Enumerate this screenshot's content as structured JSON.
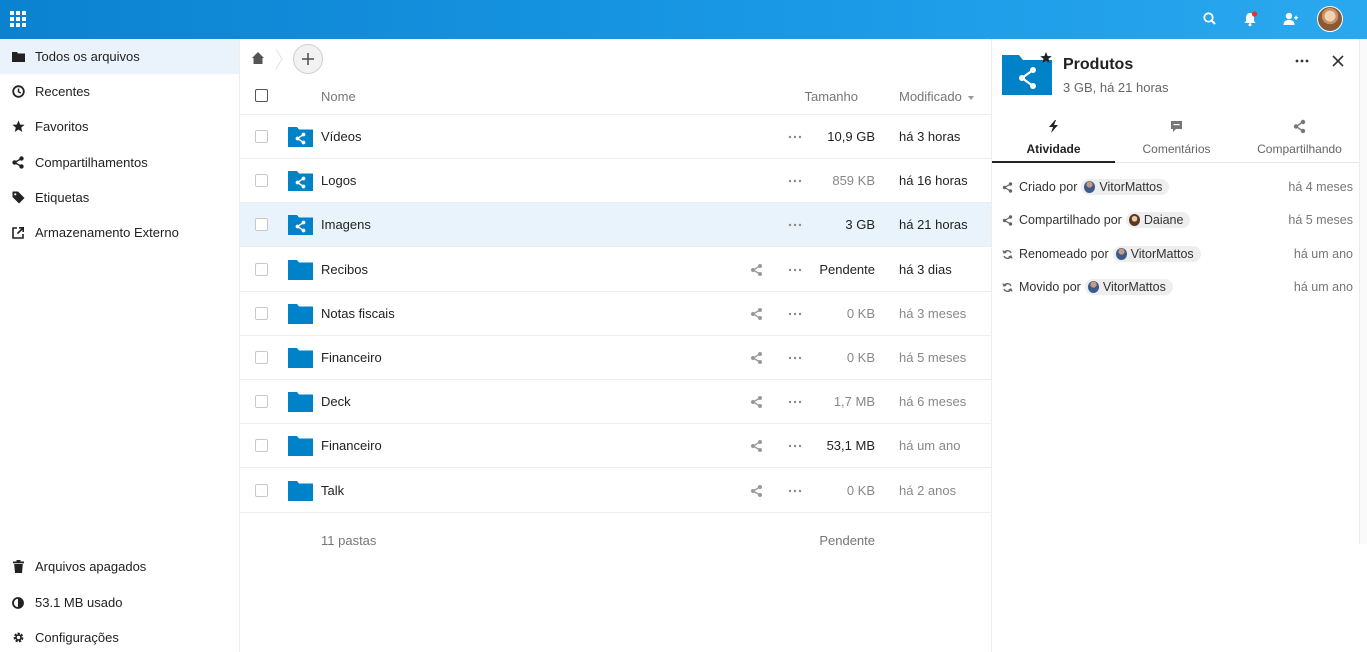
{
  "header": {
    "apps_icon": "apps-grid-icon",
    "search_icon": "search-icon",
    "notifications_icon": "bell-icon",
    "contacts_icon": "contacts-icon",
    "avatar": "user-avatar"
  },
  "sidebar": {
    "items": [
      {
        "label": "Todos os arquivos",
        "icon": "folder-icon"
      },
      {
        "label": "Recentes",
        "icon": "clock-icon"
      },
      {
        "label": "Favoritos",
        "icon": "star-icon"
      },
      {
        "label": "Compartilhamentos",
        "icon": "share-icon"
      },
      {
        "label": "Etiquetas",
        "icon": "tag-icon"
      },
      {
        "label": "Armazenamento Externo",
        "icon": "external-link-icon"
      }
    ],
    "bottom": [
      {
        "label": "Arquivos apagados",
        "icon": "trash-icon"
      },
      {
        "label": "53.1 MB usado",
        "icon": "quota-pie-icon"
      },
      {
        "label": "Configurações",
        "icon": "gear-icon"
      }
    ]
  },
  "files": {
    "columns": {
      "name": "Nome",
      "size": "Tamanho",
      "modified": "Modificado"
    },
    "rows": [
      {
        "name": "Vídeos",
        "size": "10,9 GB",
        "modified": "há 3 horas",
        "shared": true
      },
      {
        "name": "Logos",
        "size": "859 KB",
        "modified": "há 16 horas",
        "shared": true
      },
      {
        "name": "Imagens",
        "size": "3 GB",
        "modified": "há 21 horas",
        "shared": true
      },
      {
        "name": "Recibos",
        "size": "Pendente",
        "modified": "há 3 dias",
        "shared": false
      },
      {
        "name": "Notas fiscais",
        "size": "0 KB",
        "modified": "há 3 meses",
        "shared": false
      },
      {
        "name": "Financeiro",
        "size": "0 KB",
        "modified": "há 5 meses",
        "shared": false
      },
      {
        "name": "Deck",
        "size": "1,7 MB",
        "modified": "há 6 meses",
        "shared": false
      },
      {
        "name": "Financeiro",
        "size": "53,1 MB",
        "modified": "há um ano",
        "shared": false
      },
      {
        "name": "Talk",
        "size": "0 KB",
        "modified": "há 2 anos",
        "shared": false
      }
    ],
    "summary": {
      "count": "11 pastas",
      "size": "Pendente"
    }
  },
  "details": {
    "title": "Produtos",
    "subtitle": "3 GB, há 21 horas",
    "tabs": [
      {
        "label": "Atividade"
      },
      {
        "label": "Comentários"
      },
      {
        "label": "Compartilhando"
      }
    ],
    "activities": [
      {
        "text": "Criado por",
        "user": "VitorMattos",
        "time": "há 4 meses",
        "icon": "share-icon"
      },
      {
        "text": "Compartilhado por",
        "user": "Daiane",
        "time": "há 5 meses",
        "icon": "share-icon"
      },
      {
        "text": "Renomeado por",
        "user": "VitorMattos",
        "time": "há um ano",
        "icon": "refresh-icon"
      },
      {
        "text": "Movido por",
        "user": "VitorMattos",
        "time": "há um ano",
        "icon": "refresh-icon"
      }
    ]
  },
  "colors": {
    "accent": "#0082c9",
    "header": "#1a9ae6",
    "selected_row": "#e8f3fb"
  }
}
